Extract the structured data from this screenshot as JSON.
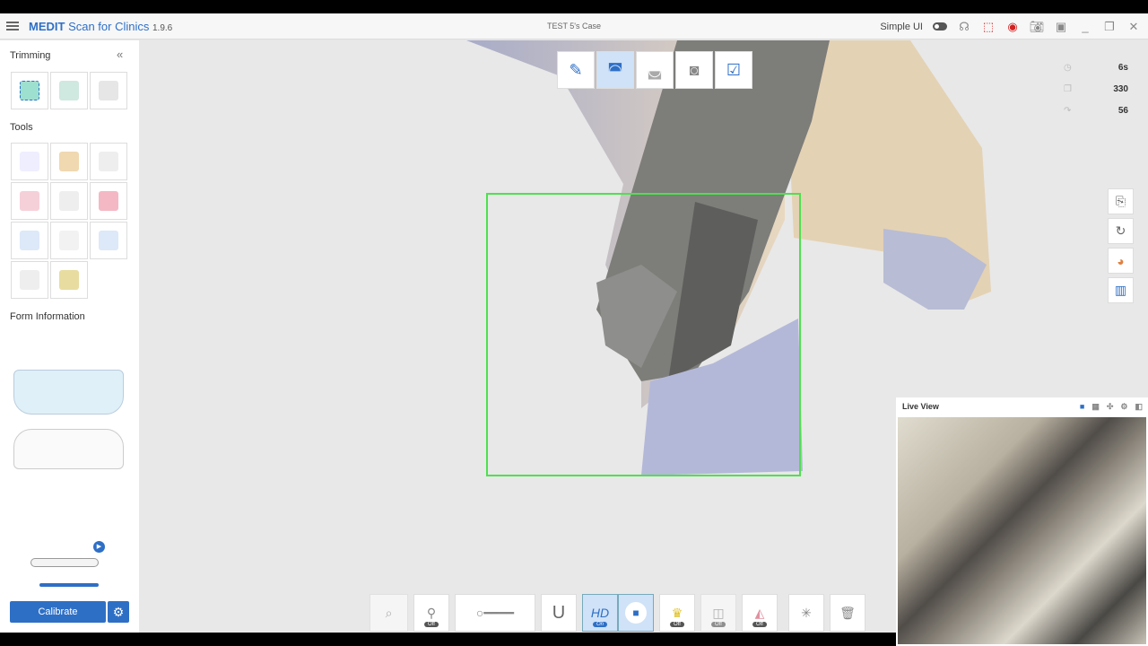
{
  "app": {
    "name_bold": "MEDIT",
    "name_rest": " Scan for Clinics ",
    "version": "1.9.6",
    "case_title": "TEST 5's Case"
  },
  "titlebar": {
    "simple_ui_label": "Simple UI",
    "simple_ui_on": false
  },
  "sidebar": {
    "trimming": "Trimming",
    "tools": "Tools",
    "form_info": "Form Information",
    "calibrate": "Calibrate"
  },
  "stats": {
    "time": "6s",
    "frames": "330",
    "count": "56"
  },
  "live_view": {
    "title": "Live View"
  },
  "bottombar": {
    "hd_label": "HD",
    "hd_toggle": "On",
    "off_label": "Off"
  },
  "colors": {
    "accent": "#2e6fc6",
    "scan_box": "#4ee04e",
    "record": "#d32020"
  }
}
